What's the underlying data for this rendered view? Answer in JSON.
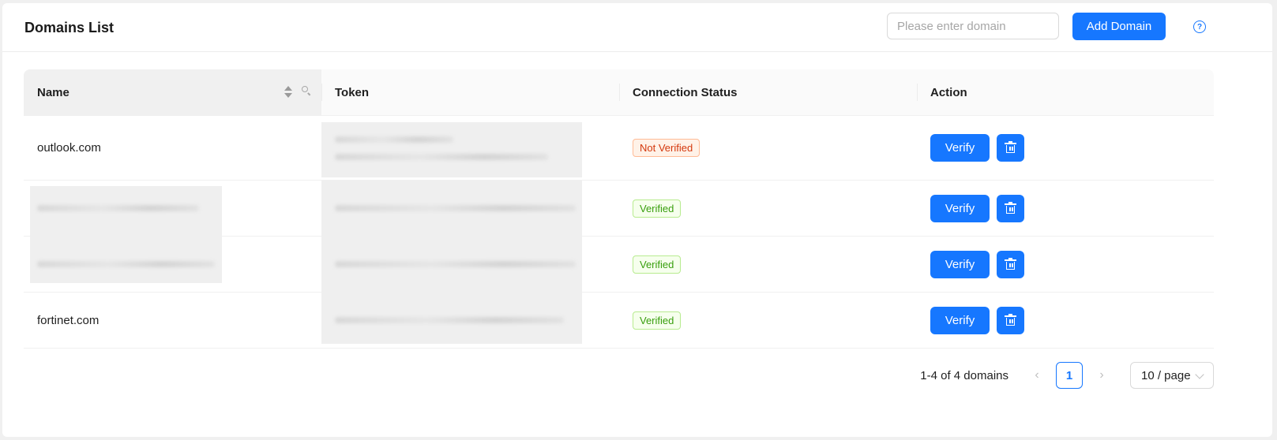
{
  "header": {
    "title": "Domains List",
    "search_placeholder": "Please enter domain",
    "add_label": "Add Domain",
    "help_icon": "question-circle-icon"
  },
  "table": {
    "columns": [
      "Name",
      "Token",
      "Connection Status",
      "Action"
    ],
    "rows": [
      {
        "name": "outlook.com",
        "name_redacted": false,
        "token_redacted": true,
        "token_lines": 2,
        "status": "Not Verified",
        "status_kind": "warning"
      },
      {
        "name": "",
        "name_redacted": true,
        "token_redacted": true,
        "token_lines": 1,
        "status": "Verified",
        "status_kind": "success"
      },
      {
        "name": "",
        "name_redacted": true,
        "token_redacted": true,
        "token_lines": 1,
        "status": "Verified",
        "status_kind": "success"
      },
      {
        "name": "fortinet.com",
        "name_redacted": false,
        "token_redacted": true,
        "token_lines": 1,
        "status": "Verified",
        "status_kind": "success"
      }
    ],
    "verify_label": "Verify",
    "delete_icon": "trash-icon"
  },
  "pagination": {
    "total_text": "1-4 of 4 domains",
    "current_page": "1",
    "page_size": "10 / page"
  },
  "colors": {
    "primary": "#1677ff",
    "warning": "#d4380d",
    "success": "#389e0d"
  }
}
